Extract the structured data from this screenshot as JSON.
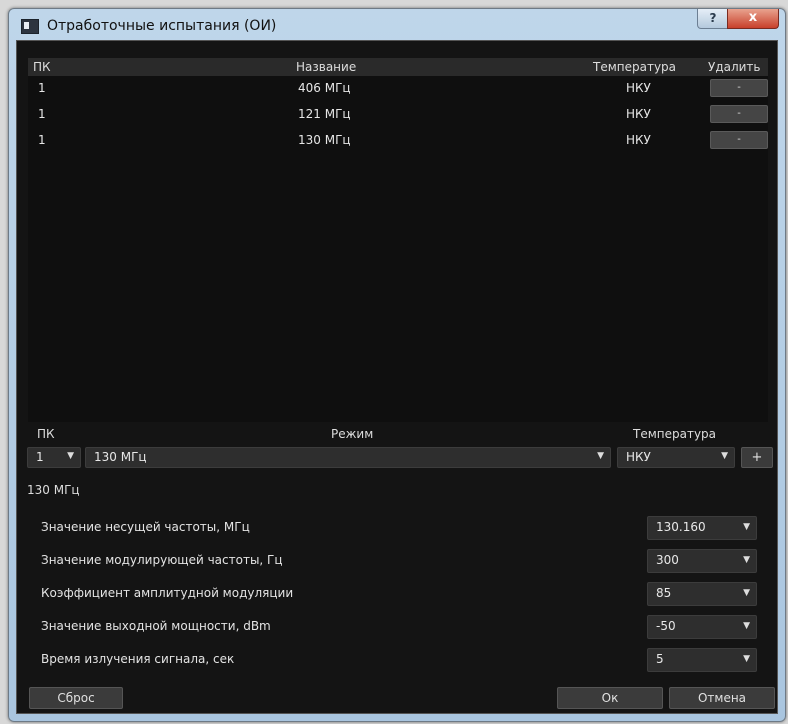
{
  "window": {
    "title": "Отработочные испытания (ОИ)",
    "help_label": "?",
    "close_label": "x"
  },
  "table": {
    "columns": [
      "ПК",
      "Название",
      "Температура",
      "Удалить"
    ],
    "rows": [
      {
        "pk": "1",
        "name": "406 МГц",
        "temp": "НКУ",
        "del": "-"
      },
      {
        "pk": "1",
        "name": "121 МГц",
        "temp": "НКУ",
        "del": "-"
      },
      {
        "pk": "1",
        "name": "130 МГц",
        "temp": "НКУ",
        "del": "-"
      }
    ]
  },
  "editor": {
    "pk_label": "ПК",
    "mode_label": "Режим",
    "temp_label": "Температура",
    "pk_value": "1",
    "mode_value": "130 МГц",
    "temp_value": "НКУ",
    "add_label": "+",
    "group_title": "130 МГц"
  },
  "params": [
    {
      "label": "Значение несущей частоты, МГц",
      "value": "130.160"
    },
    {
      "label": "Значение модулирующей частоты, Гц",
      "value": "300"
    },
    {
      "label": "Коэффициент амплитудной модуляции",
      "value": "85"
    },
    {
      "label": "Значение выходной мощности, dBm",
      "value": "-50"
    },
    {
      "label": "Время излучения сигнала, сек",
      "value": "5"
    }
  ],
  "buttons": {
    "reset": "Сброс",
    "ok": "Ок",
    "cancel": "Отмена"
  },
  "icons": {
    "dropdown": "chevron-down-icon",
    "window": "app-window-icon"
  }
}
